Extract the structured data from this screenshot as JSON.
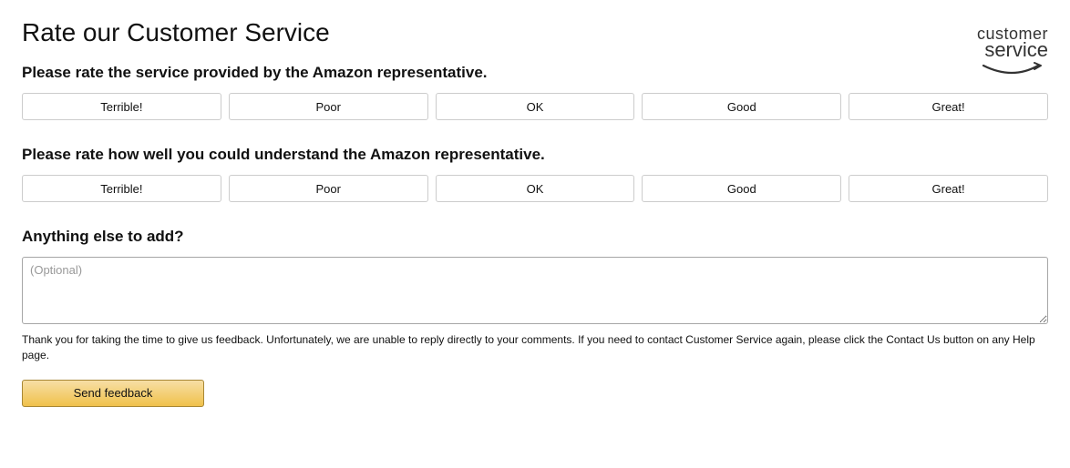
{
  "header": {
    "title": "Rate our Customer Service",
    "logo_line1": "customer",
    "logo_line2": "service"
  },
  "question1": {
    "label": "Please rate the service provided by the Amazon representative.",
    "options": [
      "Terrible!",
      "Poor",
      "OK",
      "Good",
      "Great!"
    ]
  },
  "question2": {
    "label": "Please rate how well you could understand the Amazon representative.",
    "options": [
      "Terrible!",
      "Poor",
      "OK",
      "Good",
      "Great!"
    ]
  },
  "comments": {
    "label": "Anything else to add?",
    "placeholder": "(Optional)"
  },
  "disclaimer": "Thank you for taking the time to give us feedback. Unfortunately, we are unable to reply directly to your comments. If you need to contact Customer Service again, please click the Contact Us button on any Help page.",
  "submit_label": "Send feedback"
}
